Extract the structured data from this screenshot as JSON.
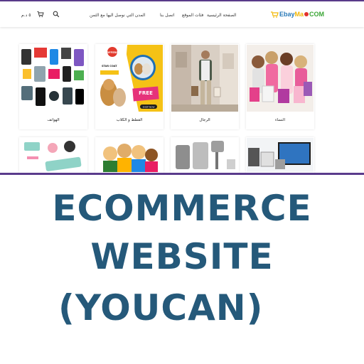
{
  "colors": {
    "accent": "#5a3b8c",
    "title": "#25597a"
  },
  "header": {
    "logo": {
      "part1": "Ebay",
      "part2": "Ma",
      "part3": "COM"
    },
    "nav": [
      {
        "label": "الصفحة الرئيسية"
      },
      {
        "label": "فئات الموقع"
      },
      {
        "label": "اتصل بنا"
      },
      {
        "label": "المدن التي نوصل اليها مع الثمن"
      }
    ],
    "price": "٥ د.م",
    "cart_icon": "cart-icon",
    "search_icon": "search-icon"
  },
  "categories": [
    {
      "label": "النساء",
      "icon": "women-shopping-image"
    },
    {
      "label": "الرجال",
      "icon": "men-fashion-image"
    },
    {
      "label": "القطط و الكلاب",
      "icon": "pets-offer-image"
    },
    {
      "label": "الهواتف",
      "icon": "phones-image"
    },
    {
      "label": "",
      "icon": "electronics-image"
    },
    {
      "label": "",
      "icon": "kitchen-appliances-image"
    },
    {
      "label": "",
      "icon": "kids-image"
    },
    {
      "label": "",
      "icon": "fitness-image"
    }
  ],
  "pet_banner": {
    "offers": "OFFERS",
    "star": "STAR COAT",
    "free": "FREE",
    "shop": "SHOP NOW"
  },
  "overlay": {
    "line1": "ECOMMERCE",
    "line2": "WEBSITE",
    "line3": "(YOUCAN)"
  }
}
